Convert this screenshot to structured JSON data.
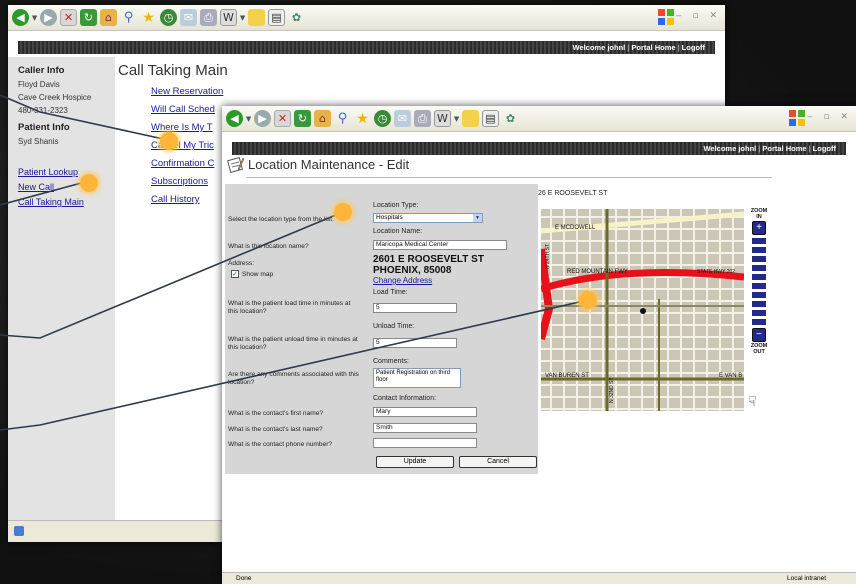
{
  "colors": {
    "marker": "#ffb43a",
    "link": "#1a1a9a",
    "banner": "#333333",
    "zoom": "#222a8a"
  },
  "portal": {
    "welcome": "Welcome johnl",
    "portal_home": "Portal Home",
    "logoff": "Logoff",
    "sep": "|"
  },
  "window1": {
    "sidebar": {
      "caller_heading": "Caller Info",
      "caller_name": "Floyd Davis",
      "caller_org": "Cave Creek Hospice",
      "caller_phone": "480-331-2323",
      "patient_heading": "Patient Info",
      "patient_name": "Syd Shanis",
      "links": [
        "Patient Lookup",
        "New Call",
        "Call Taking Main"
      ]
    },
    "title": "Call Taking Main",
    "menu": [
      "New Reservation",
      "Will Call Sched",
      "Where Is My T",
      "Cancel My Tric",
      "Confirmation C",
      "Subscriptions",
      "Call History"
    ]
  },
  "window2": {
    "title": "Location Maintenance - Edit",
    "map_address": "26   E ROOSEVELT ST",
    "form": {
      "q_location_type": "Select the location type from the list.",
      "location_type_label": "Location Type:",
      "location_type_value": "Hospitals",
      "location_name_label": "Location Name:",
      "q_location_name": "What is this location name?",
      "location_name_value": "Maricopa Medical Center",
      "address_label": "Address:",
      "address_line1": "2601 E ROOSEVELT ST",
      "address_line2": "PHOENIX, 85008",
      "change_address": "Change Address",
      "show_map": "Show map",
      "load_time_label": "Load Time:",
      "q_load_time": "What is the patient load time in minutes at this location?",
      "load_time_value": "5",
      "unload_time_label": "Unload Time:",
      "q_unload_time": "What is the patient unload time in minutes at this location?",
      "unload_time_value": "5",
      "comments_label": "Comments:",
      "q_comments": "Are there any comments associated with this location?",
      "comments_value": "Patient Registration on third floor",
      "contact_label": "Contact Information:",
      "q_first_name": "What is the contact's first name?",
      "first_name_value": "Mary",
      "q_last_name": "What is the contact's last name?",
      "last_name_value": "Smith",
      "q_phone": "What is the contact phone number?",
      "phone_value": "",
      "update_button": "Update",
      "cancel_button": "Cancel"
    },
    "map": {
      "street_mcdowell": "E MCDOWELL",
      "street_redmtn": "RED MOUNTAIN FWY",
      "street_vanburen": "VAN BUREN ST",
      "street_vand": "E VAN B",
      "street_state": "STATE HWY 202",
      "street_v1": "N 24TH ST",
      "street_v2": "N 32ND ST",
      "zoom_in": "ZOOM IN",
      "zoom_out": "ZOOM OUT"
    },
    "status": {
      "done": "Done",
      "zone": "Local intranet"
    }
  }
}
